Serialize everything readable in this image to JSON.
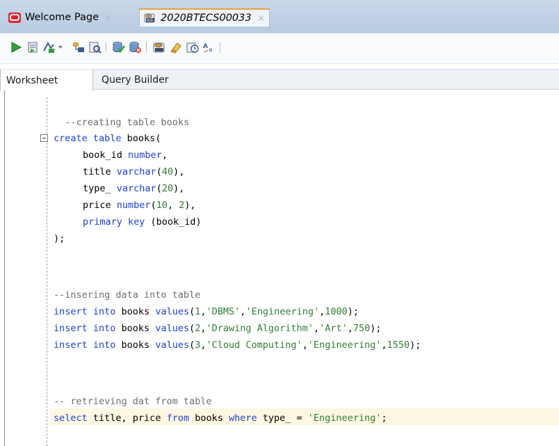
{
  "tabs": [
    {
      "label": "Welcome Page",
      "icon": "oracle-icon",
      "close": "×"
    },
    {
      "label": "2020BTECS00033",
      "icon": "sql-file-icon",
      "close": "×"
    }
  ],
  "toolbar": {
    "buttons": [
      "run-statement",
      "run-script",
      "autotrace",
      "explain-plan",
      "sql-tuning-advisor",
      "commit",
      "rollback",
      "unshared-sql-worksheet",
      "clear",
      "sql-history",
      "format"
    ]
  },
  "subtabs": {
    "worksheet": "Worksheet",
    "query_builder": "Query Builder"
  },
  "editor": {
    "line1": {
      "c": "--creating table books"
    },
    "line2": {
      "k1": "create table",
      "p1": " books("
    },
    "line3": {
      "p1": "book_id ",
      "k1": "number",
      "p2": ","
    },
    "line4": {
      "p1": "title ",
      "k1": "varchar",
      "p2": "(",
      "n1": "40",
      "p3": "),"
    },
    "line5": {
      "p1": "type_ ",
      "k1": "varchar",
      "p2": "(",
      "n1": "20",
      "p3": "),"
    },
    "line6": {
      "p1": "price ",
      "k1": "number",
      "p2": "(",
      "n1": "10",
      "p3": ", ",
      "n2": "2",
      "p4": "),"
    },
    "line7": {
      "k1": "primary key",
      "p1": " (book_id)"
    },
    "line8": {
      "p1": ");"
    },
    "line9": {
      "c": "--insering data into table"
    },
    "line10": {
      "k1": "insert into",
      "p1": " books ",
      "k2": "values",
      "p2": "(",
      "n1": "1",
      "p3": ",",
      "s1": "'DBMS'",
      "p4": ",",
      "s2": "'Engineering'",
      "p5": ",",
      "n2": "1000",
      "p6": ");"
    },
    "line11": {
      "k1": "insert into",
      "p1": " books ",
      "k2": "values",
      "p2": "(",
      "n1": "2",
      "p3": ",",
      "s1": "'Drawing Algorithm'",
      "p4": ",",
      "s2": "'Art'",
      "p5": ",",
      "n2": "750",
      "p6": ");"
    },
    "line12": {
      "k1": "insert into",
      "p1": " books ",
      "k2": "values",
      "p2": "(",
      "n1": "3",
      "p3": ",",
      "s1": "'Cloud Computing'",
      "p4": ",",
      "s2": "'Engineering'",
      "p5": ",",
      "n2": "1550",
      "p6": ");"
    },
    "line13": {
      "c": "-- retrieving dat from table"
    },
    "line14": {
      "k1": "select",
      "p1": " title, price ",
      "k2": "from",
      "p2": " books ",
      "k3": "where",
      "p3": " type_ = ",
      "s1": "'Engineering'",
      "p4": ";"
    }
  },
  "colors": {
    "keyword": "#1f3fd6",
    "string": "#2f7d32",
    "comment": "#6d6d6d",
    "current_line": "#fdf7e3"
  }
}
